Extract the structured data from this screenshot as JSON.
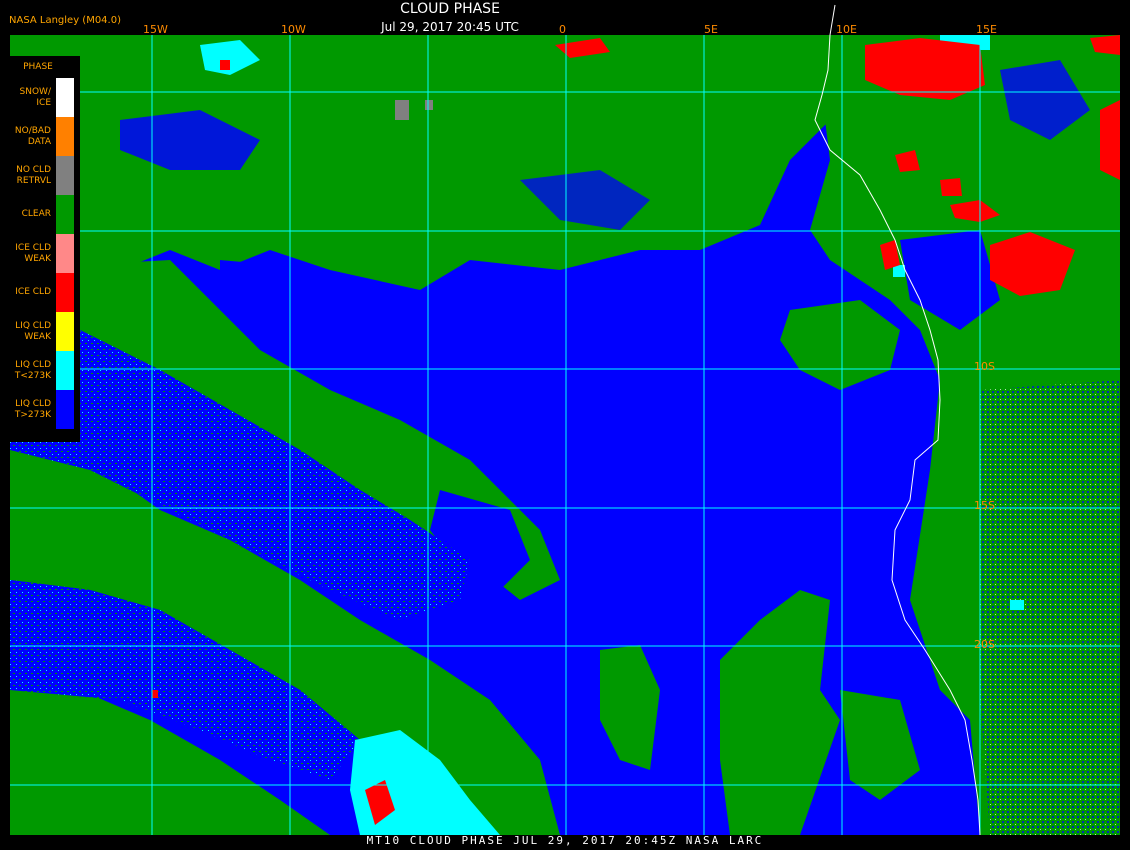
{
  "header": {
    "title": "CLOUD PHASE",
    "subtitle": "Jul 29, 2017 20:45 UTC",
    "version": "NASA Langley (M04.0)"
  },
  "longitude_labels": [
    "15W",
    "10W",
    "0",
    "5E",
    "10E",
    "15E"
  ],
  "latitude_labels": [
    "10S",
    "15S",
    "20S"
  ],
  "legend": {
    "title": "PHASE",
    "items": [
      {
        "label": "SNOW/\nICE",
        "color": "#ffffff"
      },
      {
        "label": "NO/BAD\nDATA",
        "color": "#ff8000"
      },
      {
        "label": "NO CLD\nRETRVL",
        "color": "#808080"
      },
      {
        "label": "CLEAR",
        "color": "#009900"
      },
      {
        "label": "ICE CLD\nWEAK",
        "color": "#ff8888"
      },
      {
        "label": "ICE CLD",
        "color": "#ff0000"
      },
      {
        "label": "LIQ CLD\nWEAK",
        "color": "#ffff00"
      },
      {
        "label": "LIQ CLD\nT<273K",
        "color": "#00ffff"
      },
      {
        "label": "LIQ CLD\nT>273K",
        "color": "#0000ff"
      }
    ]
  },
  "footer": "MT10  CLOUD PHASE  JUL 29, 2017 20:45Z  NASA LARC",
  "colors": {
    "background": "#000000",
    "grid": "#00ffff",
    "coastline": "#ffffff",
    "label": "#ff8c00"
  }
}
